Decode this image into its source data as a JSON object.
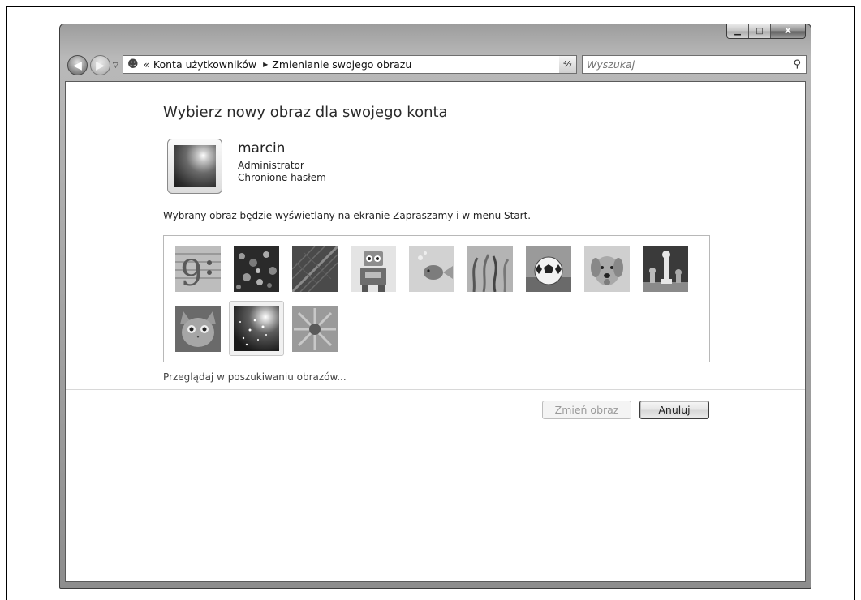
{
  "window": {
    "caption_buttons": {
      "minimize_glyph": "▁",
      "maximize_glyph": "□",
      "close_glyph": "X"
    }
  },
  "toolbar": {
    "back_glyph": "◀",
    "forward_glyph": "▶",
    "history_dropdown_glyph": "▽",
    "address": {
      "icon_name": "user-accounts-icon",
      "overflow_glyph": "«",
      "breadcrumbs": [
        "Konta użytkowników",
        "Zmienianie swojego obrazu"
      ],
      "crumb_arrow_glyph": "▶",
      "dropdown_glyph": "▼"
    },
    "refresh_glyph": "⁴⁄₇",
    "search": {
      "placeholder": "Wyszukaj",
      "icon_name": "search-icon"
    }
  },
  "main": {
    "title": "Wybierz nowy obraz dla swojego konta",
    "user": {
      "name": "marcin",
      "role": "Administrator",
      "password_status": "Chronione hasłem"
    },
    "info_text": "Wybrany obraz będzie wyświetlany na ekranie Zapraszamy i w menu Start.",
    "pictures": [
      {
        "subject": "bass-clef",
        "selected": false
      },
      {
        "subject": "beads",
        "selected": false
      },
      {
        "subject": "leaf",
        "selected": false
      },
      {
        "subject": "robot",
        "selected": false
      },
      {
        "subject": "goldfish",
        "selected": false
      },
      {
        "subject": "seaweed",
        "selected": false
      },
      {
        "subject": "soccer-ball",
        "selected": false
      },
      {
        "subject": "dog",
        "selected": false
      },
      {
        "subject": "chess",
        "selected": false
      },
      {
        "subject": "kitten",
        "selected": false
      },
      {
        "subject": "stars",
        "selected": true
      },
      {
        "subject": "flower",
        "selected": false
      }
    ],
    "browse_link": "Przeglądaj w poszukiwaniu obrazów...",
    "buttons": {
      "change_label": "Zmień obraz",
      "cancel_label": "Anuluj"
    }
  }
}
